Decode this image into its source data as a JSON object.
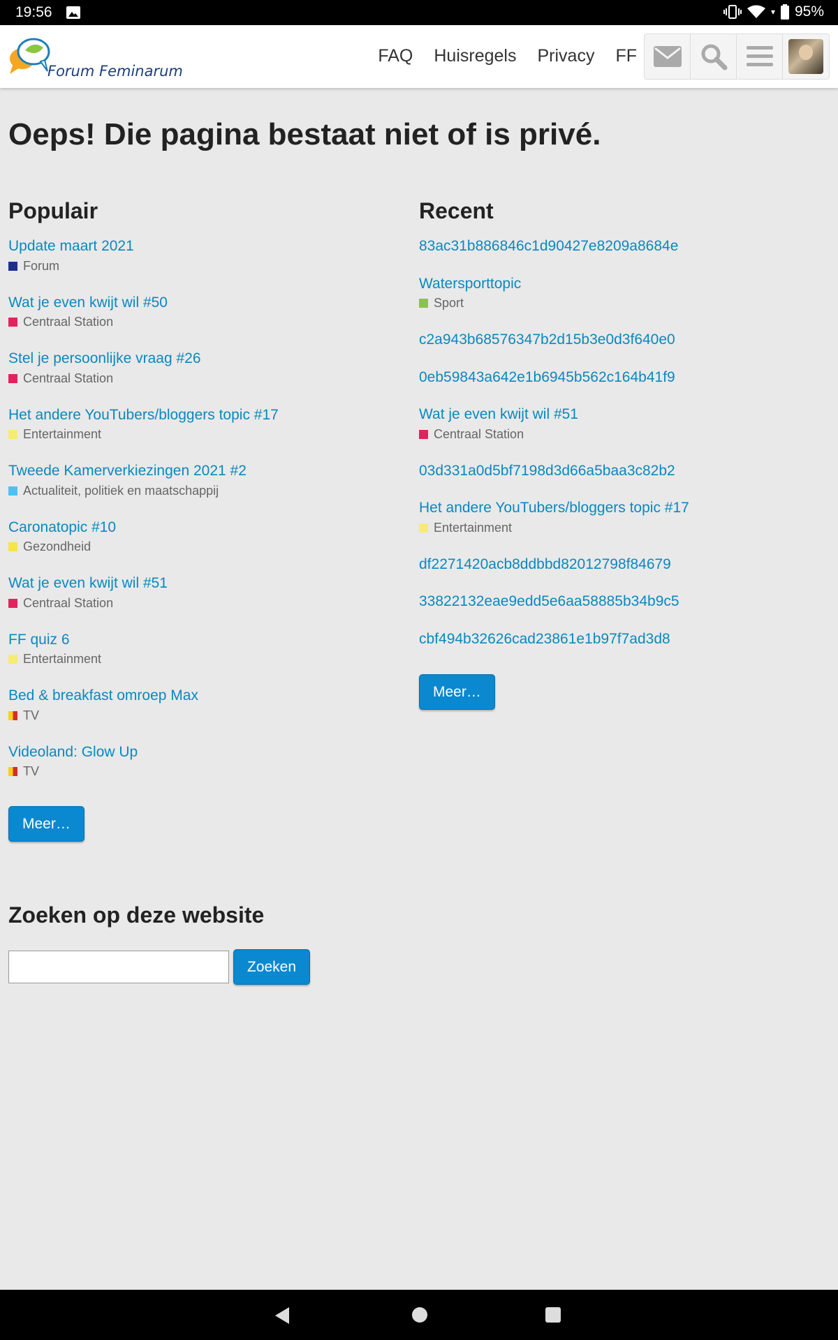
{
  "status_bar": {
    "time": "19:56",
    "battery": "95%",
    "icons": [
      "gallery-icon",
      "vibrate-icon",
      "wifi-icon",
      "battery-icon"
    ]
  },
  "header": {
    "logo_text": "Forum Feminarum",
    "nav": [
      "FAQ",
      "Huisregels",
      "Privacy",
      "FF"
    ],
    "icons": [
      "envelope-icon",
      "search-icon",
      "menu-icon",
      "avatar"
    ]
  },
  "page_title": "Oeps! Die pagina bestaat niet of is privé.",
  "popular": {
    "heading": "Populair",
    "topics": [
      {
        "title": "Update maart 2021",
        "category": "Forum",
        "color": "#1e2f8a"
      },
      {
        "title": "Wat je even kwijt wil #50",
        "category": "Centraal Station",
        "color": "#e0245e"
      },
      {
        "title": "Stel je persoonlijke vraag #26",
        "category": "Centraal Station",
        "color": "#e0245e"
      },
      {
        "title": "Het andere YouTubers/bloggers topic #17",
        "category": "Entertainment",
        "color": "#f7ec73"
      },
      {
        "title": "Tweede Kamerverkiezingen 2021 #2",
        "category": "Actualiteit, politiek en maatschappij",
        "color": "#4fc1f0"
      },
      {
        "title": "Caronatopic #10",
        "category": "Gezondheid",
        "color": "#f5e546"
      },
      {
        "title": "Wat je even kwijt wil #51",
        "category": "Centraal Station",
        "color": "#e0245e"
      },
      {
        "title": "FF quiz 6",
        "category": "Entertainment",
        "color": "#f7ec73"
      },
      {
        "title": "Bed & breakfast omroep Max",
        "category": "TV",
        "color": "split"
      },
      {
        "title": "Videoland: Glow Up",
        "category": "TV",
        "color": "split"
      }
    ],
    "more_label": "Meer…"
  },
  "recent": {
    "heading": "Recent",
    "topics": [
      {
        "title": "83ac31b886846c1d90427e8209a8684e"
      },
      {
        "title": "Watersporttopic",
        "category": "Sport",
        "color": "#8bc34a"
      },
      {
        "title": "c2a943b68576347b2d15b3e0d3f640e0"
      },
      {
        "title": "0eb59843a642e1b6945b562c164b41f9"
      },
      {
        "title": "Wat je even kwijt wil #51",
        "category": "Centraal Station",
        "color": "#e0245e"
      },
      {
        "title": "03d331a0d5bf7198d3d66a5baa3c82b2"
      },
      {
        "title": "Het andere YouTubers/bloggers topic #17",
        "category": "Entertainment",
        "color": "#f7ec73"
      },
      {
        "title": "df2271420acb8ddbbd82012798f84679"
      },
      {
        "title": "33822132eae9edd5e6aa58885b34b9c5"
      },
      {
        "title": "cbf494b32626cad23861e1b97f7ad3d8"
      }
    ],
    "more_label": "Meer…"
  },
  "search": {
    "heading": "Zoeken op deze website",
    "input_value": "",
    "button_label": "Zoeken"
  },
  "android_nav": [
    "back-icon",
    "home-icon",
    "recents-icon"
  ]
}
